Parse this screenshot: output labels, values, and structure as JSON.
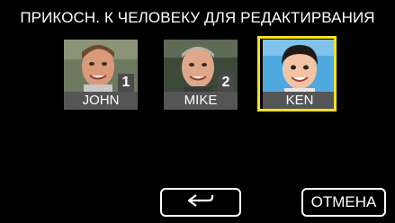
{
  "title": "ПРИКОСН. К ЧЕЛОВЕКУ ДЛЯ РЕДАКТИРВАНИЯ",
  "faces": [
    {
      "name": "JOHN",
      "badge": "1"
    },
    {
      "name": "MIKE",
      "badge": "2"
    },
    {
      "name": "KEN",
      "badge": "",
      "selected": true
    }
  ],
  "buttons": {
    "back_icon": "return-arrow-icon",
    "cancel_label": "ОТМЕНА"
  },
  "colors": {
    "background": "#000000",
    "selection": "#f5e11a",
    "label_bg": "#555555"
  }
}
